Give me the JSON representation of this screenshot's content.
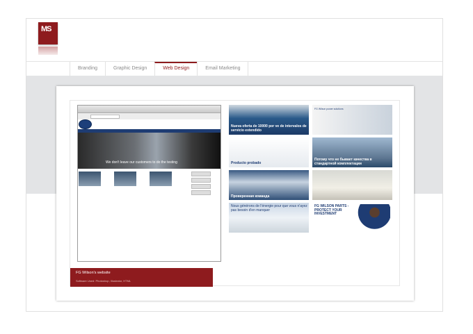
{
  "logo": {
    "text": "MS",
    "icon": "ms-logo"
  },
  "nav": {
    "tabs": [
      {
        "label": "Branding"
      },
      {
        "label": "Graphic Design"
      },
      {
        "label": "Web Design"
      },
      {
        "label": "Email Marketing"
      }
    ]
  },
  "project": {
    "title": "FG Wilson's website",
    "software": "Software Used: Photoshop, Illustrator, HTML",
    "hero_caption": "We don't leave our customers to do the testing"
  },
  "tiles": [
    {
      "text": "Nueva oferta de 10000 por ve de intervalos de servicio extendido"
    },
    {
      "text": "FG Wilson power solutions"
    },
    {
      "text": "Producto probado"
    },
    {
      "text": "Потому что не бывает качества в стандартной комплектации"
    },
    {
      "text": "Проверенная команда"
    },
    {
      "text": ""
    },
    {
      "text": "Nous générons de l'énergie pour que vous n'ayez pas besoin d'en manquer"
    },
    {
      "text": "FG WILSON PARTS - PROTECT YOUR INVESTMENT"
    }
  ],
  "colors": {
    "accent": "#8e1b1e",
    "band": "#e3e4e6",
    "navy": "#1e3c73"
  }
}
